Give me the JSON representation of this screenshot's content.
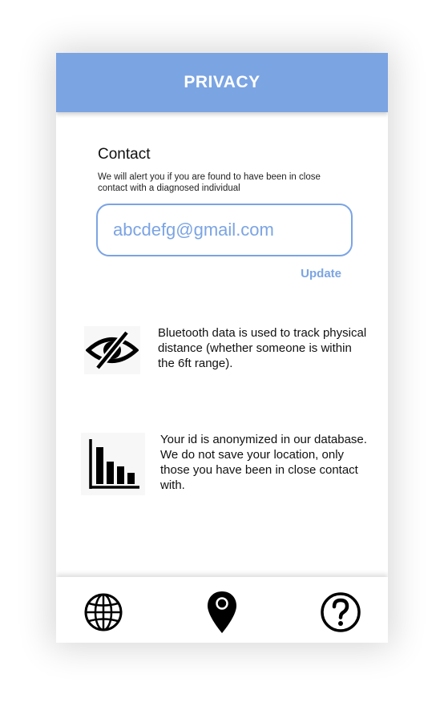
{
  "header": {
    "title": "PRIVACY"
  },
  "contact": {
    "title": "Contact",
    "description": "We will alert you if you are found to have been in close contact with a diagnosed individual",
    "email_value": "abcdefg@gmail.com",
    "update_label": "Update"
  },
  "info": [
    {
      "icon": "eye-slash-icon",
      "text": "Bluetooth data is used to track physical distance (whether someone is within the 6ft range)."
    },
    {
      "icon": "bar-chart-icon",
      "text": "Your id is anonymized in our database. We do not save your location, only those you have been in close contact with."
    }
  ],
  "nav": [
    {
      "icon": "globe-icon"
    },
    {
      "icon": "map-pin-icon"
    },
    {
      "icon": "question-circle-icon"
    }
  ],
  "colors": {
    "accent": "#7ba4e3",
    "text": "#111111",
    "background": "#ffffff"
  }
}
